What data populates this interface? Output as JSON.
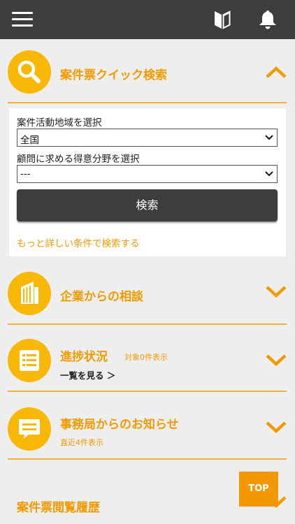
{
  "quick_search": {
    "title": "案件票クイック検索",
    "region_label": "案件活動地域を選択",
    "region_value": "全国",
    "field_label": "顧問に求める得意分野を選択",
    "field_value": "---",
    "search_button": "検索",
    "detail_link": "もっと詳しい条件で検索する"
  },
  "sections": {
    "consultation": {
      "title": "企業からの相談"
    },
    "progress": {
      "title": "進捗状況",
      "count_text": "対象0件表示",
      "view_all": "一覧を見る ＞"
    },
    "notice": {
      "title": "事務局からのお知らせ",
      "count_text": "直近4件表示"
    },
    "history": {
      "title": "案件票閲覧履歴"
    }
  },
  "top_button": "TOP",
  "colors": {
    "accent": "#f29a00",
    "circle": "#f9b806",
    "header": "#3d3d3d"
  }
}
